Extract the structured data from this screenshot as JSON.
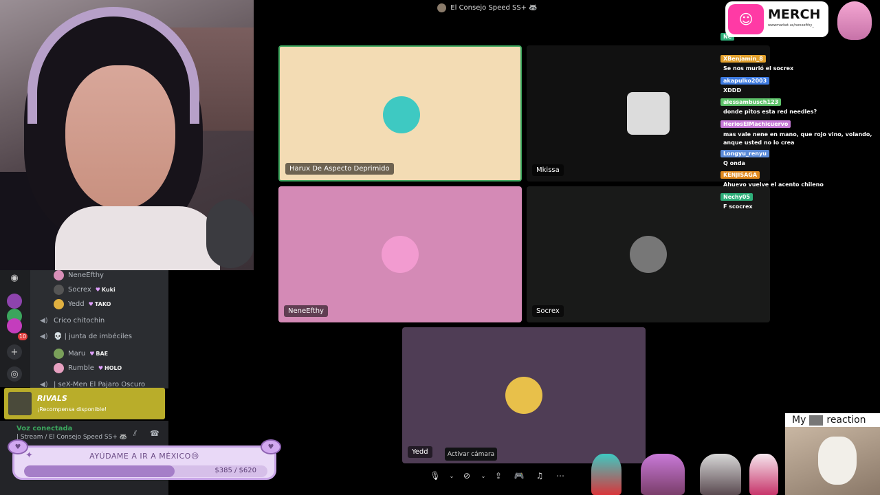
{
  "window": {
    "title": "El Consejo Speed SS+ 🦝"
  },
  "servers": [
    {
      "icon": "discord-icon",
      "glyph": "◉",
      "color": "#5865f2"
    },
    {
      "icon": "server-purple",
      "glyph": "●",
      "color": "#8e44ad"
    },
    {
      "icon": "server-green",
      "glyph": "●",
      "color": "#3ba55d"
    },
    {
      "icon": "server-pink",
      "glyph": "●",
      "color": "#c43dbd"
    },
    {
      "icon": "add-server-icon",
      "glyph": "+",
      "color": "#313338"
    },
    {
      "icon": "discover-icon",
      "glyph": "◎",
      "color": "#313338"
    }
  ],
  "server_badge": "10",
  "voice_list": {
    "users_top": [
      {
        "name": "NeneEfthy",
        "tag": "",
        "color": "#d88fb8"
      },
      {
        "name": "Socrex",
        "tag": "Kuki",
        "color": "#555555"
      },
      {
        "name": "Yedd",
        "tag": "TAKO",
        "color": "#e0b040"
      }
    ],
    "channels": [
      {
        "name": "Crico chitochin"
      },
      {
        "name": "💀 | junta de imbéciles"
      }
    ],
    "users_bottom": [
      {
        "name": "Maru",
        "tag": "BAE",
        "color": "#7aa05a"
      },
      {
        "name": "Rumble",
        "tag": "HOLO",
        "color": "#e6a0c0"
      }
    ],
    "partial_channel": "| seX-Men El Pajaro Oscuro"
  },
  "reward": {
    "brand": "RIVALS",
    "text": "¡Recompensa disponible!"
  },
  "voice_connected": {
    "status": "Voz conectada",
    "channel": "| Stream / El Consejo Speed SS+ 🦝"
  },
  "goal": {
    "title": "AYÚDAME A IR A MÉXICO😢",
    "amount": "$385 / $620",
    "progress": 0.62
  },
  "tiles": [
    {
      "name": "Harux De Aspecto Deprimido",
      "bg": "#f3dcb4",
      "avatar": "#3ec9c2"
    },
    {
      "name": "Mkissa",
      "bg": "#111111",
      "avatar": "#dcdcdc"
    },
    {
      "name": "NeneEfthy",
      "bg": "#d48ab6",
      "avatar": "#f29bd0"
    },
    {
      "name": "Socrex",
      "bg": "#191a19",
      "avatar": "#777777"
    },
    {
      "name": "Yedd",
      "bg": "#4f3d55",
      "avatar": "#e8c04a"
    }
  ],
  "tooltip": "Activar cámara",
  "toolbar": [
    {
      "icon": "microphone-icon",
      "glyph": "🎙"
    },
    {
      "icon": "chevron-down-icon",
      "glyph": "⌄"
    },
    {
      "icon": "camera-off-icon",
      "glyph": "⊘"
    },
    {
      "icon": "chevron-down-icon",
      "glyph": "⌄"
    },
    {
      "icon": "screen-share-icon",
      "glyph": "⇪"
    },
    {
      "icon": "activity-icon",
      "glyph": "🎮"
    },
    {
      "icon": "soundboard-icon",
      "glyph": "♫"
    },
    {
      "icon": "more-icon",
      "glyph": "⋯"
    }
  ],
  "chat": [
    {
      "user": "Ne",
      "color": "#2fb07a",
      "text": ""
    },
    {
      "user": "XBenjamin_8",
      "color": "#e2a02c",
      "text": "Se nos murió el socrex"
    },
    {
      "user": "akapulko2003",
      "color": "#3d7ae0",
      "text": "XDDD"
    },
    {
      "user": "alessambusch123",
      "color": "#5ec26a",
      "text": "donde pitos esta red needles?"
    },
    {
      "user": "HeriosElMachicuervo",
      "color": "#c77ad8",
      "text": "mas vale nene en mano, que rojo vino, volando, anque usted no lo crea"
    },
    {
      "user": "Longyu_renyu",
      "color": "#5a8ad8",
      "text": "Q onda"
    },
    {
      "user": "KENJISAGA",
      "color": "#e08a20",
      "text": "Ahuevo vuelve el acento chileno"
    },
    {
      "user": "Nechy05",
      "color": "#2fb07a",
      "text": "F scocrex"
    }
  ],
  "merch": {
    "word": "MERCH",
    "url": "wwwmarket.us/neneefthy_"
  },
  "reaction": {
    "prefix": "My",
    "suffix": "reaction"
  }
}
